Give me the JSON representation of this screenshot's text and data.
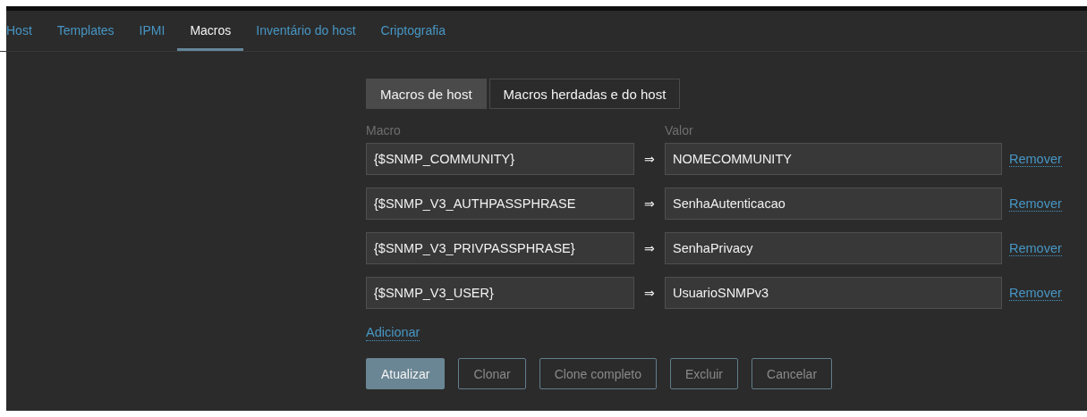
{
  "tabs": [
    {
      "label": "Host",
      "selected": false
    },
    {
      "label": "Templates",
      "selected": false
    },
    {
      "label": "IPMI",
      "selected": false
    },
    {
      "label": "Macros",
      "selected": true
    },
    {
      "label": "Inventário do host",
      "selected": false
    },
    {
      "label": "Criptografia",
      "selected": false
    }
  ],
  "macro_modes": [
    {
      "label": "Macros de host",
      "selected": true
    },
    {
      "label": "Macros herdadas e do host",
      "selected": false
    }
  ],
  "columns": {
    "macro": "Macro",
    "value": "Valor"
  },
  "macros": [
    {
      "macro": "{$SNMP_COMMUNITY}",
      "arrow": "⇒",
      "value": "NOMECOMMUNITY",
      "remove": "Remover"
    },
    {
      "macro": "{$SNMP_V3_AUTHPASSPHRASE",
      "arrow": "⇒",
      "value": "SenhaAutenticacao",
      "remove": "Remover"
    },
    {
      "macro": "{$SNMP_V3_PRIVPASSPHRASE}",
      "arrow": "⇒",
      "value": "SenhaPrivacy",
      "remove": "Remover"
    },
    {
      "macro": "{$SNMP_V3_USER}",
      "arrow": "⇒",
      "value": "UsuarioSNMPv3",
      "remove": "Remover"
    }
  ],
  "add_link": "Adicionar",
  "buttons": [
    {
      "label": "Atualizar",
      "kind": "primary"
    },
    {
      "label": "Clonar",
      "kind": "secondary"
    },
    {
      "label": "Clone completo",
      "kind": "secondary"
    },
    {
      "label": "Excluir",
      "kind": "secondary"
    },
    {
      "label": "Cancelar",
      "kind": "secondary"
    }
  ]
}
